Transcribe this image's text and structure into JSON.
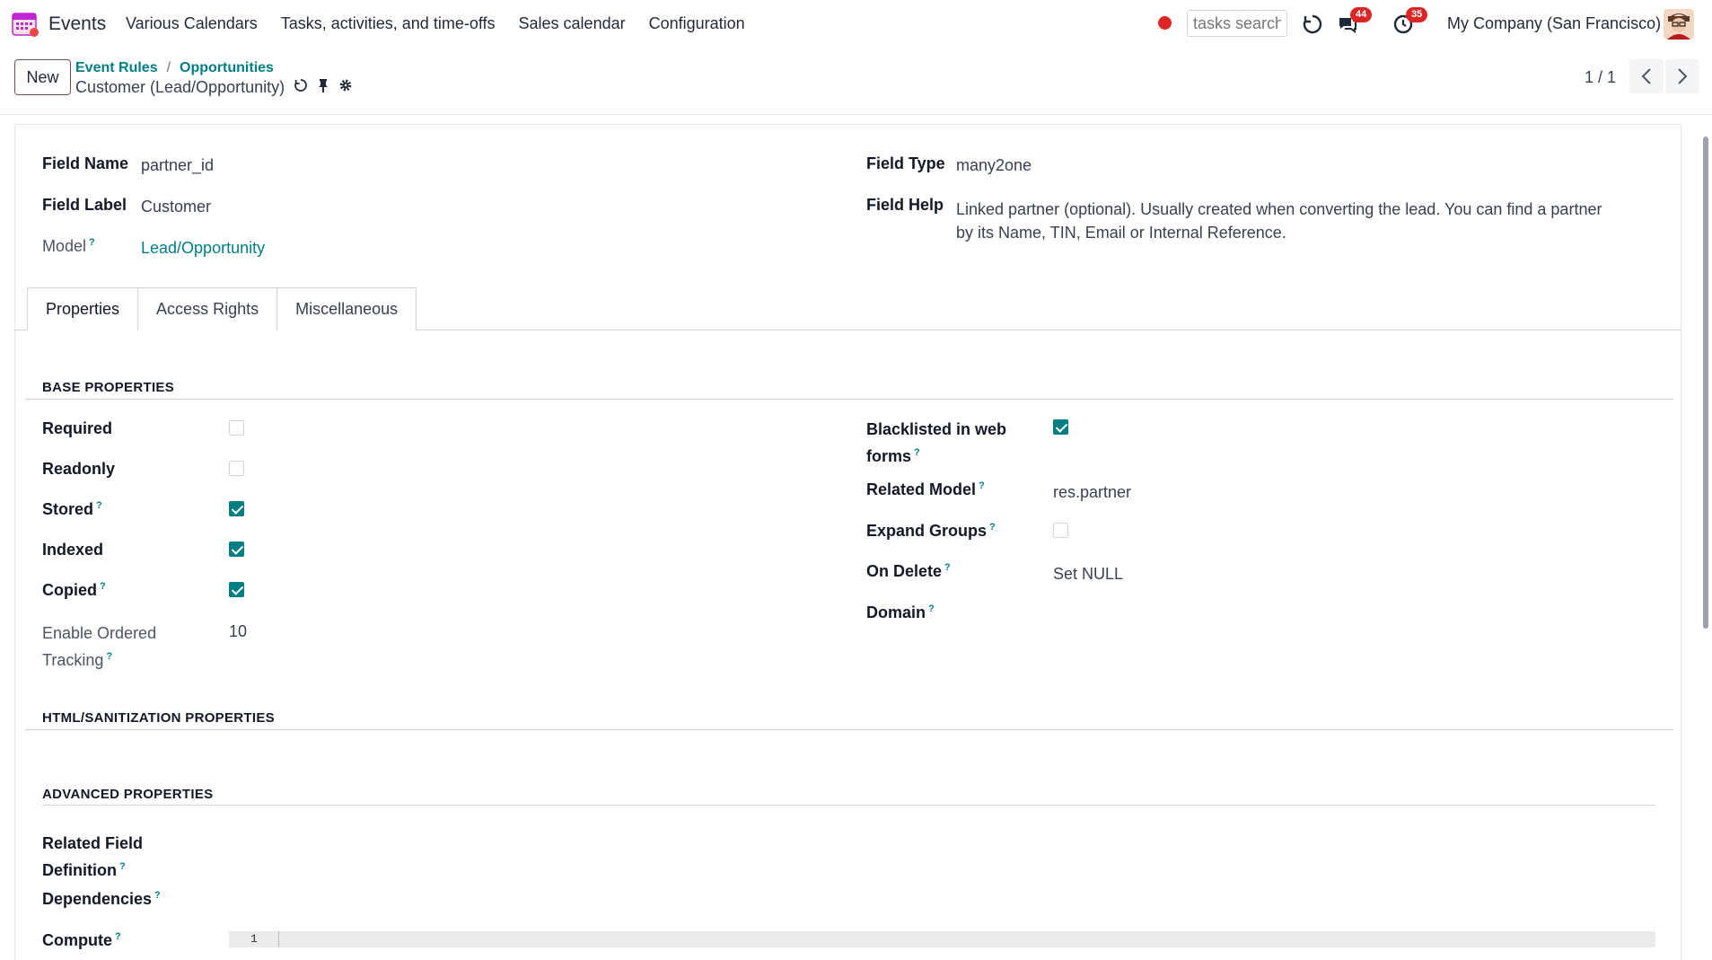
{
  "app": {
    "name": "Events"
  },
  "menu": [
    "Various Calendars",
    "Tasks, activities, and time-offs",
    "Sales calendar",
    "Configuration"
  ],
  "search": {
    "placeholder": "tasks search"
  },
  "badges": {
    "messages": "44",
    "activities": "35"
  },
  "company": "My Company (San Francisco)",
  "control": {
    "new_label": "New",
    "breadcrumb": [
      "Event Rules",
      "Opportunities"
    ],
    "breadcrumb_sep": "/",
    "record_title": "Customer (Lead/Opportunity)",
    "pager": "1 / 1"
  },
  "header_fields": {
    "field_name_label": "Field Name",
    "field_name": "partner_id",
    "field_label_label": "Field Label",
    "field_label": "Customer",
    "model_label": "Model",
    "model": "Lead/Opportunity",
    "field_type_label": "Field Type",
    "field_type": "many2one",
    "field_help_label": "Field Help",
    "field_help": "Linked partner (optional). Usually created when converting the lead. You can find a partner by its Name, TIN, Email or Internal Reference."
  },
  "tabs": [
    "Properties",
    "Access Rights",
    "Miscellaneous"
  ],
  "base_properties": {
    "title": "BASE PROPERTIES",
    "required": {
      "label": "Required",
      "checked": false
    },
    "readonly": {
      "label": "Readonly",
      "checked": false
    },
    "stored": {
      "label": "Stored",
      "checked": true
    },
    "indexed": {
      "label": "Indexed",
      "checked": true
    },
    "copied": {
      "label": "Copied",
      "checked": true
    },
    "ordered_tracking": {
      "label_line1": "Enable Ordered",
      "label_line2": "Tracking",
      "value": "10"
    },
    "blacklisted": {
      "label_line1": "Blacklisted in web",
      "label_line2": "forms",
      "checked": true
    },
    "related_model": {
      "label": "Related Model",
      "value": "res.partner"
    },
    "expand_groups": {
      "label": "Expand Groups",
      "checked": false
    },
    "on_delete": {
      "label": "On Delete",
      "value": "Set NULL"
    },
    "domain": {
      "label": "Domain"
    }
  },
  "html_section": {
    "title": "HTML/SANITIZATION PROPERTIES"
  },
  "advanced": {
    "title": "ADVANCED PROPERTIES",
    "related_label_line1": "Related Field",
    "related_label_line2": "Definition",
    "dependencies_label": "Dependencies",
    "compute_label": "Compute",
    "code_line": "1"
  },
  "help_mark": "?",
  "colors": {
    "accent": "#017e84",
    "brand": "#714b67",
    "danger": "#dc2626"
  },
  "icons": [
    "calendar-app-icon",
    "record-dot-icon",
    "refresh-icon",
    "chat-icon",
    "clock-icon",
    "pin-icon",
    "gear-icon",
    "chevron-left-icon",
    "chevron-right-icon",
    "user-avatar"
  ]
}
